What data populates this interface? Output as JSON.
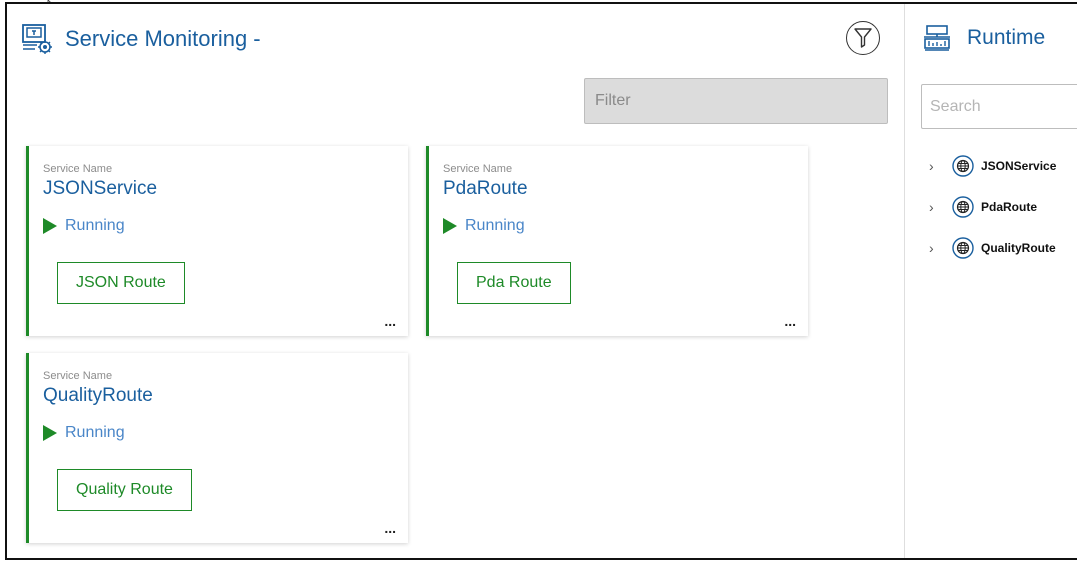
{
  "header": {
    "title": "Service Monitoring -"
  },
  "filter": {
    "placeholder": "Filter"
  },
  "services": [
    {
      "label": "Service Name",
      "name": "JSONService",
      "status": "Running",
      "route_label": "JSON Route",
      "more": "..."
    },
    {
      "label": "Service Name",
      "name": "PdaRoute",
      "status": "Running",
      "route_label": "Pda Route",
      "more": "..."
    },
    {
      "label": "Service Name",
      "name": "QualityRoute",
      "status": "Running",
      "route_label": "Quality Route",
      "more": "..."
    }
  ],
  "runtime": {
    "title": "Runtime",
    "search_placeholder": "Search",
    "items": [
      {
        "label": "JSONService"
      },
      {
        "label": "PdaRoute"
      },
      {
        "label": "QualityRoute"
      }
    ]
  },
  "colors": {
    "accent_green": "#1e8a28",
    "title_blue": "#1a5f9e",
    "status_blue": "#4a86c8"
  },
  "icons": [
    "monitor-settings-icon",
    "filter-icon",
    "play-icon",
    "more-icon",
    "runtime-icon",
    "chevron-right-icon",
    "globe-icon",
    "cursor-icon"
  ]
}
